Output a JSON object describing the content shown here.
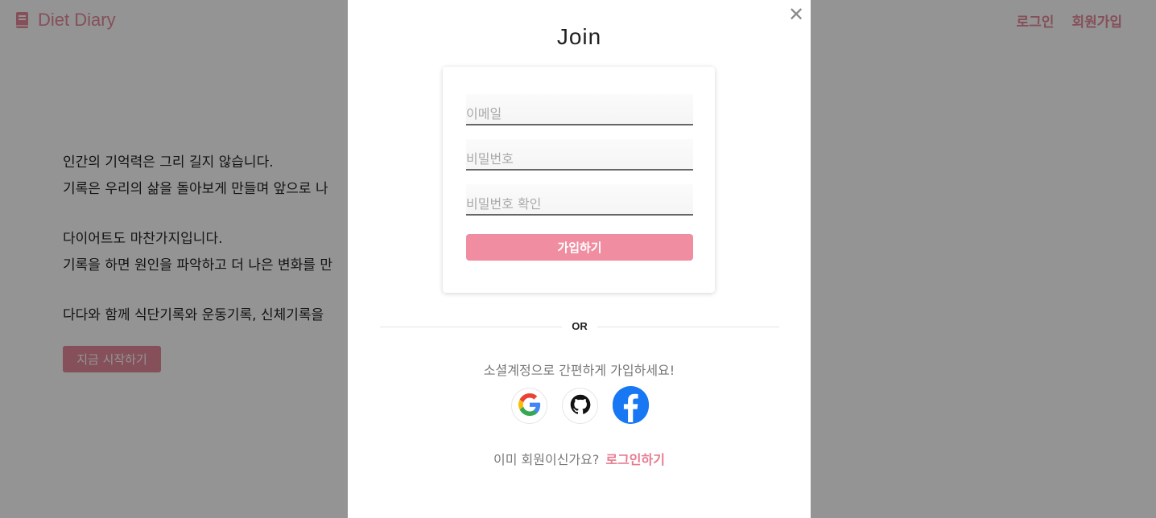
{
  "app": {
    "logo_text": "Diet Diary",
    "logo_icon": "book-icon",
    "accent_color": "#e68a9c"
  },
  "nav": {
    "login": "로그인",
    "signup": "회원가입"
  },
  "hero": {
    "lines": [
      "인간의 기억력은 그리 길지 않습니다.",
      "기록은 우리의 삶을 돌아보게 만들며 앞으로 나",
      "다이어트도 마찬가지입니다.",
      "기록을 하면 원인을 파악하고 더 나은 변화를 만",
      "다다와 함께 식단기록와 운동기록, 신체기록을"
    ],
    "start_button": "지금 시작하기"
  },
  "modal": {
    "title": "Join",
    "close_icon": "close-icon",
    "form": {
      "email_placeholder": "이메일",
      "password_placeholder": "비밀번호",
      "password_confirm_placeholder": "비밀번호 확인",
      "submit_label": "가입하기"
    },
    "divider_text": "OR",
    "social_text": "소셜계정으로 간편하게 가입하세요!",
    "socials": [
      "google-icon",
      "github-icon",
      "facebook-icon"
    ],
    "footer_text": "이미 회원이신가요?",
    "footer_link": "로그인하기"
  }
}
